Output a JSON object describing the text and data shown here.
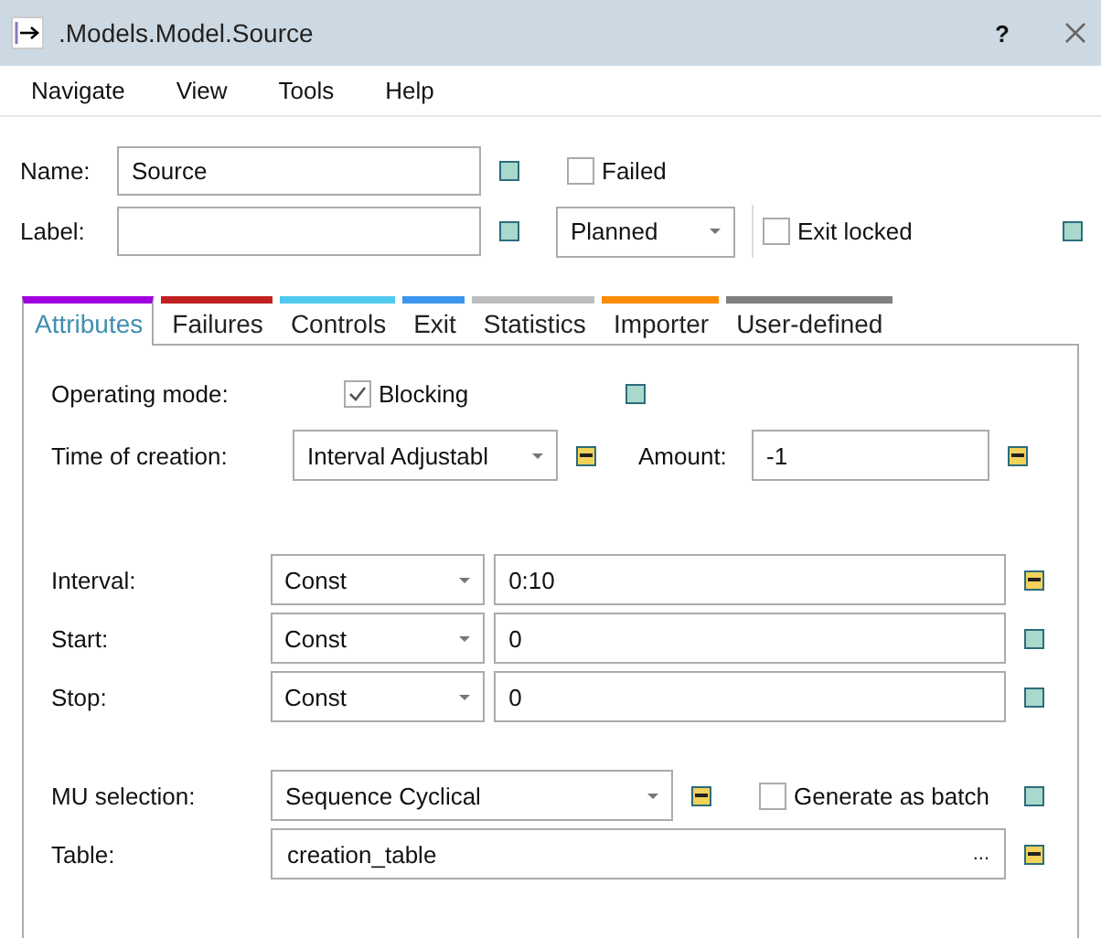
{
  "window": {
    "title": ".Models.Model.Source",
    "help": "?"
  },
  "menu": [
    "Navigate",
    "View",
    "Tools",
    "Help"
  ],
  "header": {
    "name": {
      "label": "Name:",
      "value": "Source",
      "inherited": true
    },
    "label": {
      "label": "Label:",
      "inherited": true
    },
    "failed": {
      "label": "Failed",
      "checked": false
    },
    "status": {
      "value": "Planned"
    },
    "exit_locked": {
      "label": "Exit locked",
      "checked": false,
      "inherited": true
    }
  },
  "tabs": [
    {
      "label": "Attributes",
      "color": "#a000e0",
      "selected": true
    },
    {
      "label": "Failures",
      "color": "#c02020",
      "selected": false
    },
    {
      "label": "Controls",
      "color": "#50c8f0",
      "selected": false
    },
    {
      "label": "Exit",
      "color": "#3c96f0",
      "selected": false
    },
    {
      "label": "Statistics",
      "color": "#bdbdbd",
      "selected": false
    },
    {
      "label": "Importer",
      "color": "#ff8c00",
      "selected": false
    },
    {
      "label": "User-defined",
      "color": "#808080",
      "selected": false
    }
  ],
  "attributes": {
    "operating_mode": {
      "label": "Operating mode:",
      "option": "Blocking",
      "checked": true,
      "inherited": true
    },
    "time_of_creation": {
      "label": "Time of creation:",
      "value": "Interval Adjustabl",
      "inherited": false
    },
    "amount": {
      "label": "Amount:",
      "value": "-1",
      "inherited": false
    },
    "distributions": [
      {
        "label": "Interval:",
        "type": "Const",
        "value": "0:10",
        "inherited": false
      },
      {
        "label": "Start:",
        "type": "Const",
        "value": "0",
        "inherited": true
      },
      {
        "label": "Stop:",
        "type": "Const",
        "value": "0",
        "inherited": true
      }
    ],
    "mu_selection": {
      "label": "MU selection:",
      "value": "Sequence Cyclical",
      "inherited": false
    },
    "generate_as_batch": {
      "label": "Generate as batch",
      "checked": false,
      "inherited": true
    },
    "table": {
      "label": "Table:",
      "value": "creation_table",
      "browse": "...",
      "inherited": false
    }
  }
}
